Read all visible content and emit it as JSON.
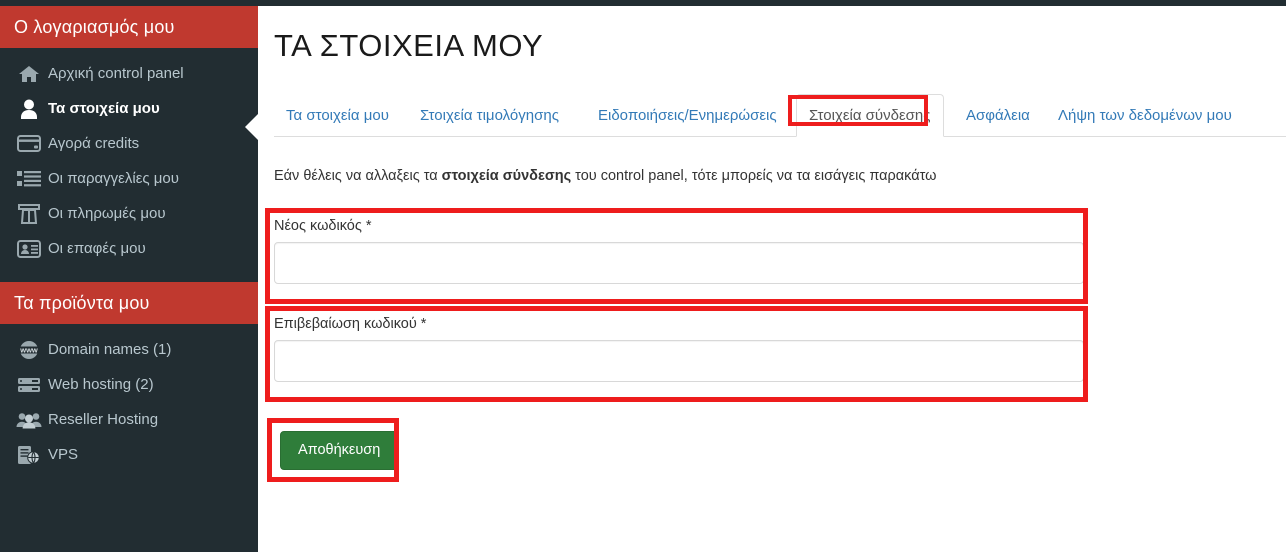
{
  "sidebar": {
    "account_header": "Ο λογαριασμός μου",
    "account_items": [
      {
        "label": "Αρχική control panel",
        "icon": "home-icon"
      },
      {
        "label": "Τα στοιχεία μου",
        "icon": "user-icon"
      },
      {
        "label": "Αγορά credits",
        "icon": "credit-card-icon"
      },
      {
        "label": "Οι παραγγελίες μου",
        "icon": "list-icon"
      },
      {
        "label": "Οι πληρωμές μου",
        "icon": "payments-icon"
      },
      {
        "label": "Οι επαφές μου",
        "icon": "contact-card-icon"
      }
    ],
    "products_header": "Τα προϊόντα μου",
    "product_items": [
      {
        "label": "Domain names (1)",
        "icon": "www-globe-icon"
      },
      {
        "label": "Web hosting (2)",
        "icon": "server-icon"
      },
      {
        "label": "Reseller Hosting",
        "icon": "users-group-icon"
      },
      {
        "label": "VPS",
        "icon": "vps-icon"
      }
    ]
  },
  "content": {
    "title": "ΤΑ ΣΤΟΙΧΕΙΑ ΜΟΥ",
    "tabs": [
      {
        "label": "Τα στοιχεία μου",
        "active": false
      },
      {
        "label": "Στοιχεία τιμολόγησης",
        "active": false
      },
      {
        "label": "Ειδοποιήσεις/Ενημερώσεις",
        "active": false
      },
      {
        "label": "Στοιχεία σύνδεσης",
        "active": true
      },
      {
        "label": "Ασφάλεια",
        "active": false
      },
      {
        "label": "Λήψη των δεδομένων μου",
        "active": false
      }
    ],
    "intro_prefix": "Εάν θέλεις να αλλαξεις τα ",
    "intro_bold": "στοιχεία σύνδεσης",
    "intro_suffix": " του control panel, τότε μπορείς να τα εισάγεις παρακάτω",
    "new_password_label": "Νέος κωδικός *",
    "new_password_value": "",
    "new_password_placeholder": "",
    "confirm_password_label": "Επιβεβαίωση κωδικού *",
    "confirm_password_value": "",
    "confirm_password_placeholder": "",
    "save_label": "Αποθήκευση"
  },
  "colors": {
    "sidebar_bg": "#222d32",
    "header_red": "#c0392f",
    "tab_link": "#337ab7",
    "save_green": "#2f7d3a",
    "annotation_red": "#ee1d1d"
  }
}
